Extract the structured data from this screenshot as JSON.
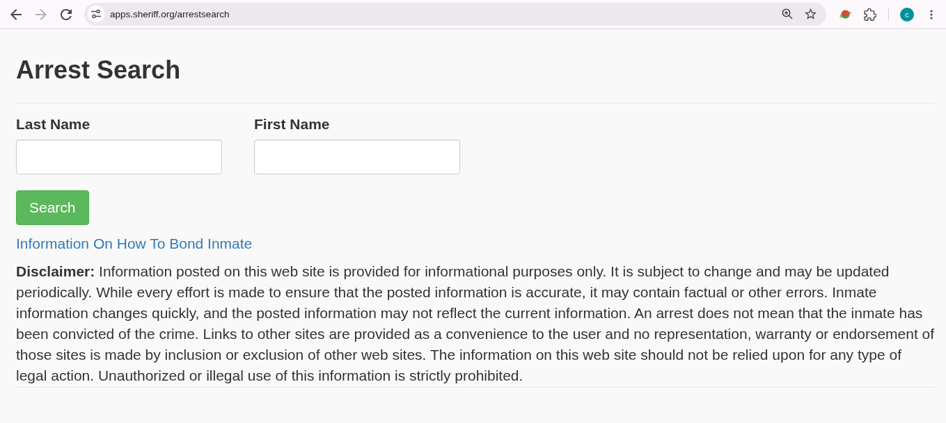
{
  "browser": {
    "nav_buttons": [
      {
        "kind": "back",
        "disabled": false
      },
      {
        "kind": "forward",
        "disabled": true
      },
      {
        "kind": "reload",
        "disabled": false
      }
    ],
    "address_bar": {
      "url": "apps.sheriff.org/arrestsearch"
    },
    "profile": {
      "initial": "c"
    }
  },
  "page": {
    "title": "Arrest Search",
    "fields": [
      {
        "label": "Last Name"
      },
      {
        "label": "First Name"
      }
    ],
    "search_button": {
      "label": "Search"
    },
    "bond_link": {
      "label": "Information On How To Bond Inmate"
    },
    "disclaimer": "**Disclaimer:** Information posted on this web site is provided for informational purposes only. It is subject to change and may be updated periodically. While every effort is made to ensure that the posted information is accurate, it may contain factual or other errors. Inmate information changes quickly, and the posted information may not reflect the current information. An arrest does not mean that the inmate has been convicted of the crime. Links to other sites are provided as a convenience to the user and no representation, warranty or endorsement of those sites is made by inclusion or exclusion of other web sites. The information on this web site should not be relied upon for any type of legal action. Unauthorized or illegal use of this information is strictly prohibited."
  }
}
